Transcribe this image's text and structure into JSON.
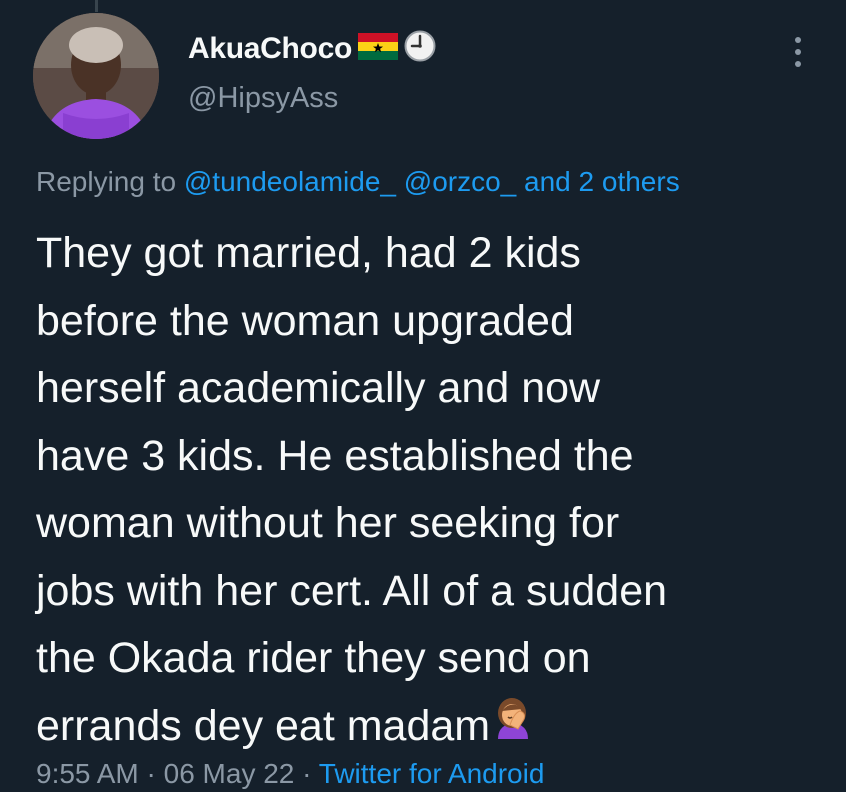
{
  "tweet": {
    "display_name": "AkuaChoco",
    "name_emojis": [
      "ghana-flag-icon",
      "clock-icon"
    ],
    "handle": "@HipsyAss",
    "replying_prefix": "Replying to ",
    "mention_1": "@tundeolamide_",
    "mention_2": "@orzco_",
    "mention_others": "and 2 others",
    "text_lines": [
      "They got married, had 2 kids",
      "before the woman upgraded",
      "herself academically and now",
      "have 3 kids. He established the",
      "woman without her seeking for",
      "jobs with her cert. All of a sudden",
      "the Okada rider they send on",
      "errands dey eat madam"
    ],
    "text_end_emoji": "woman-facepalming-icon",
    "time": "9:55 AM",
    "sep": " · ",
    "date": "06 May 22",
    "source": "Twitter for Android"
  },
  "colors": {
    "background": "#15202b",
    "text": "#f7f9f9",
    "secondary": "#8b98a5",
    "link": "#1d9bf0"
  }
}
